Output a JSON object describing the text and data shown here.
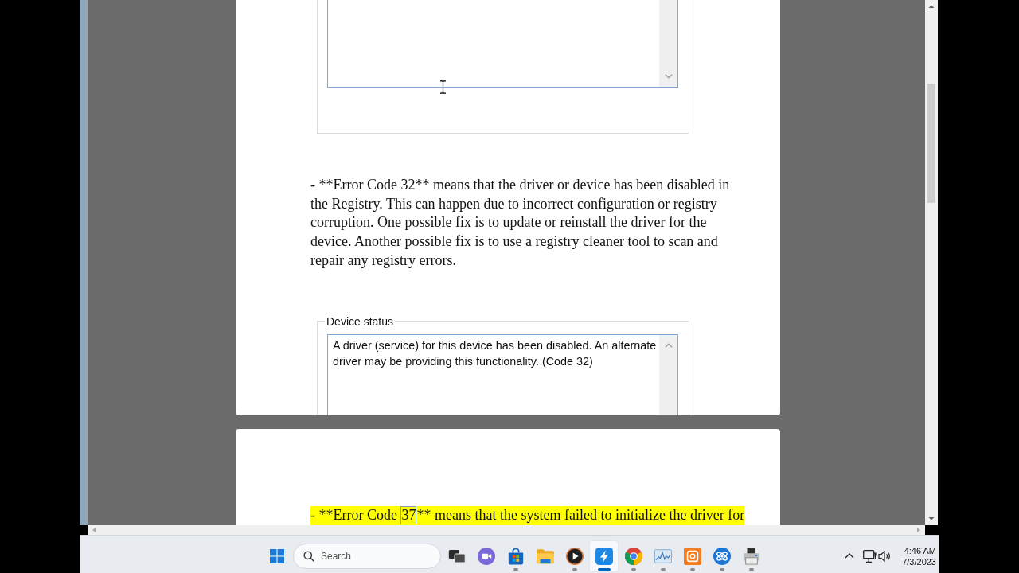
{
  "viewer": {
    "pages": [
      {
        "blocks": [
          {
            "kind": "group"
          },
          {
            "kind": "paragraph",
            "highlighted": false,
            "segments": [
              {
                "text": "- **Error Code 32** means that the driver or device has been disabled in the Registry. This can happen due to incorrect configuration or registry corruption. One possible fix is to update or reinstall the driver for the device. Another possible fix is to use a registry cleaner tool to scan and repair any registry errors.",
                "boxed": false
              }
            ]
          },
          {
            "kind": "group",
            "legend": "Device status",
            "text": "A driver (service) for this device has been disabled. An alternate driver may be providing this functionality. (Code 32)"
          }
        ]
      },
      {
        "blocks": [
          {
            "kind": "paragraph",
            "highlighted": true,
            "segments": [
              {
                "text": "- **Error Code ",
                "boxed": false
              },
              {
                "text": "37",
                "boxed": true
              },
              {
                "text": "** means that the system failed to initialize the driver for",
                "boxed": false
              }
            ]
          }
        ]
      }
    ]
  },
  "taskbar": {
    "search": {
      "placeholder": "Search"
    },
    "apps": [
      {
        "selected": false,
        "running": false
      },
      {
        "selected": false,
        "running": true
      },
      {
        "selected": false,
        "running": false
      },
      {
        "selected": false,
        "running": true
      },
      {
        "selected": true,
        "running": true
      },
      {
        "selected": false,
        "running": true
      },
      {
        "selected": false,
        "running": true
      },
      {
        "selected": false,
        "running": true
      },
      {
        "selected": false,
        "running": true
      },
      {
        "selected": false,
        "running": true
      }
    ],
    "clock": {
      "time": "4:46 AM",
      "date": "7/3/2023"
    }
  }
}
